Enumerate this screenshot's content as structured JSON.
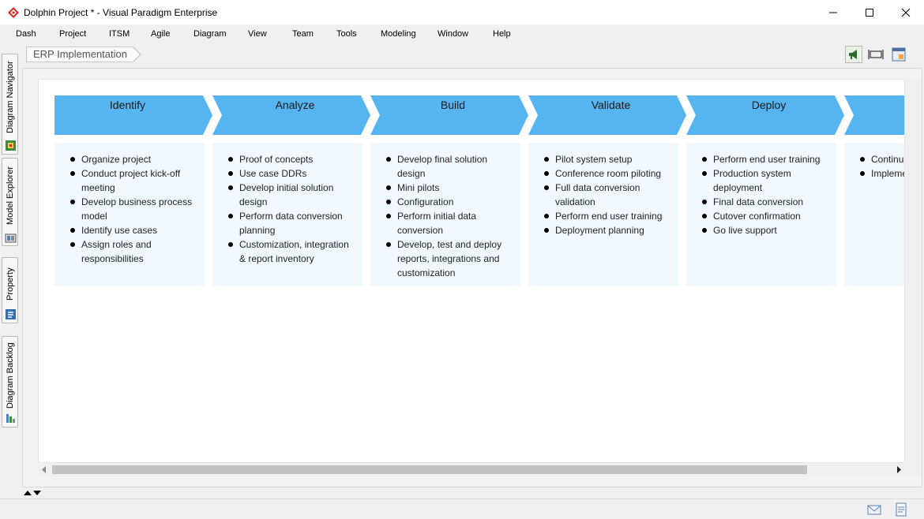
{
  "window": {
    "title": "Dolphin Project * - Visual Paradigm Enterprise",
    "minimize_glyph": "—",
    "maximize_glyph": "☐",
    "close_glyph": "✕"
  },
  "menu": {
    "items": [
      "Dash",
      "Project",
      "ITSM",
      "Agile",
      "Diagram",
      "View",
      "Team",
      "Tools",
      "Modeling",
      "Window",
      "Help"
    ]
  },
  "left_dock": {
    "tabs": [
      {
        "label": "Diagram Navigator",
        "icon": "diagram-navigator-icon"
      },
      {
        "label": "Model Explorer",
        "icon": "model-explorer-icon"
      },
      {
        "label": "Property",
        "icon": "property-icon"
      },
      {
        "label": "Diagram Backlog",
        "icon": "diagram-backlog-icon"
      }
    ]
  },
  "breadcrumb": {
    "label": "ERP Implementation"
  },
  "toolbar": {
    "icons": [
      "megaphone-icon",
      "fit-diagram-icon",
      "diagram-overview-icon"
    ]
  },
  "colors": {
    "phase_arrow": "#56b4f1",
    "phase_box": "#f1f8fd",
    "accent_red": "#d32f2f"
  },
  "phases": [
    {
      "title": "Identify",
      "items": [
        "Organize project",
        "Conduct project kick-off meeting",
        "Develop business process model",
        "Identify use cases",
        "Assign roles and responsibilities"
      ]
    },
    {
      "title": "Analyze",
      "items": [
        "Proof of concepts",
        "Use case DDRs",
        "Develop initial solution design",
        "Perform data conversion planning",
        "Customization, integration & report inventory"
      ]
    },
    {
      "title": "Build",
      "items": [
        "Develop final solution design",
        "Mini pilots",
        "Configuration",
        "Perform initial data conversion",
        "Develop, test and deploy reports, integrations and customization"
      ]
    },
    {
      "title": "Validate",
      "items": [
        "Pilot system setup",
        "Conference room piloting",
        "Full data conversion validation",
        "Perform end user training",
        "Deployment planning"
      ]
    },
    {
      "title": "Deploy",
      "items": [
        "Perform end user training",
        "Production system deployment",
        "Final data conversion",
        "Cutover confirmation",
        "Go live support"
      ]
    },
    {
      "title": "",
      "items": [
        "Continue",
        "Impleme"
      ]
    }
  ],
  "statusbar": {
    "icons": [
      "mail-icon",
      "notes-icon"
    ]
  }
}
